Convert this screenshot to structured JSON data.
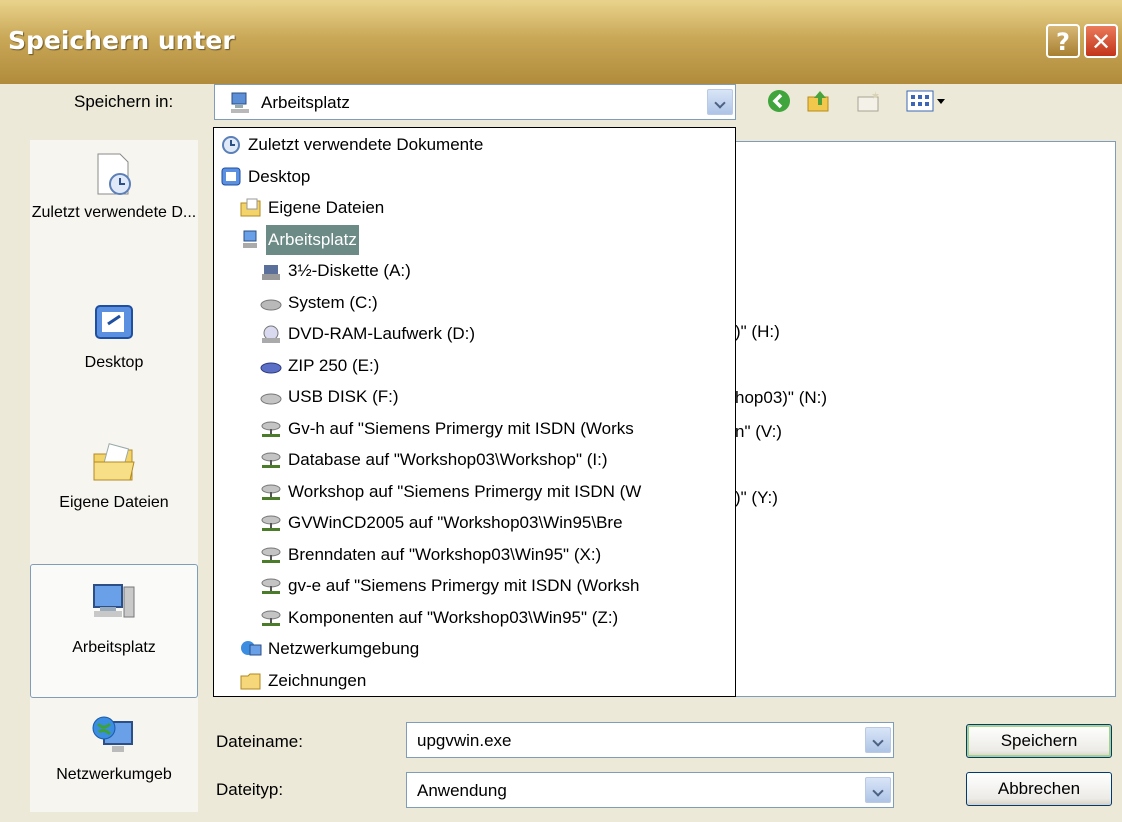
{
  "window": {
    "title": "Speichern unter",
    "help_glyph": "?",
    "close_glyph": "✕"
  },
  "save_in": {
    "label": "Speichern in:",
    "value": "Arbeitsplatz",
    "icon": "computer-icon"
  },
  "toolbar": {
    "icons": [
      "back-icon",
      "up-folder-icon",
      "new-folder-icon",
      "view-menu-icon"
    ]
  },
  "places": [
    {
      "label": "Zuletzt verwendete D...",
      "icon": "recent-documents-icon",
      "selected": false
    },
    {
      "label": "Desktop",
      "icon": "desktop-icon",
      "selected": false
    },
    {
      "label": "Eigene Dateien",
      "icon": "my-documents-icon",
      "selected": false
    },
    {
      "label": "Arbeitsplatz",
      "icon": "my-computer-icon",
      "selected": true
    },
    {
      "label": "Netzwerkumgeb",
      "icon": "network-icon",
      "selected": false
    }
  ],
  "background_list": [
    ")\" (H:)",
    "hop03)\" (N:)",
    "n\" (V:)",
    ")\" (Y:)"
  ],
  "dropdown_items": [
    {
      "label": "Zuletzt verwendete Dokumente",
      "icon": "recent-documents-icon",
      "level": 0
    },
    {
      "label": "Desktop",
      "icon": "desktop-icon",
      "level": 0
    },
    {
      "label": "Eigene Dateien",
      "icon": "my-documents-icon",
      "level": 1
    },
    {
      "label": "Arbeitsplatz",
      "icon": "my-computer-icon",
      "level": 1,
      "highlighted": true
    },
    {
      "label": "3½-Diskette (A:)",
      "icon": "floppy-icon",
      "level": 2
    },
    {
      "label": "System (C:)",
      "icon": "hard-drive-icon",
      "level": 2
    },
    {
      "label": "DVD-RAM-Laufwerk (D:)",
      "icon": "dvd-drive-icon",
      "level": 2
    },
    {
      "label": "ZIP 250 (E:)",
      "icon": "zip-drive-icon",
      "level": 2
    },
    {
      "label": "USB DISK (F:)",
      "icon": "usb-drive-icon",
      "level": 2
    },
    {
      "label": "Gv-h auf \"Siemens Primergy mit ISDN (Works",
      "icon": "network-drive-icon",
      "level": 2
    },
    {
      "label": "Database auf \"Workshop03\\Workshop\" (I:)",
      "icon": "network-drive-icon",
      "level": 2
    },
    {
      "label": "Workshop auf \"Siemens Primergy mit ISDN (W",
      "icon": "network-drive-icon",
      "level": 2
    },
    {
      "label": "GVWinCD2005 auf \"Workshop03\\Win95\\Bre",
      "icon": "network-drive-icon",
      "level": 2
    },
    {
      "label": "Brenndaten auf \"Workshop03\\Win95\" (X:)",
      "icon": "network-drive-icon",
      "level": 2
    },
    {
      "label": "gv-e auf \"Siemens Primergy mit ISDN (Worksh",
      "icon": "network-drive-icon",
      "level": 2
    },
    {
      "label": "Komponenten auf \"Workshop03\\Win95\" (Z:)",
      "icon": "network-drive-icon",
      "level": 2
    },
    {
      "label": "Netzwerkumgebung",
      "icon": "network-icon",
      "level": 1
    },
    {
      "label": "Zeichnungen",
      "icon": "folder-icon",
      "level": 1
    }
  ],
  "filename": {
    "label": "Dateiname:",
    "value": "upgvwin.exe"
  },
  "filetype": {
    "label": "Dateityp:",
    "value": "Anwendung"
  },
  "buttons": {
    "save": "Speichern",
    "cancel": "Abbrechen"
  },
  "colors": {
    "title_bar": "#c9a858",
    "highlight": "#6c8a86",
    "border": "#7f9db9"
  }
}
